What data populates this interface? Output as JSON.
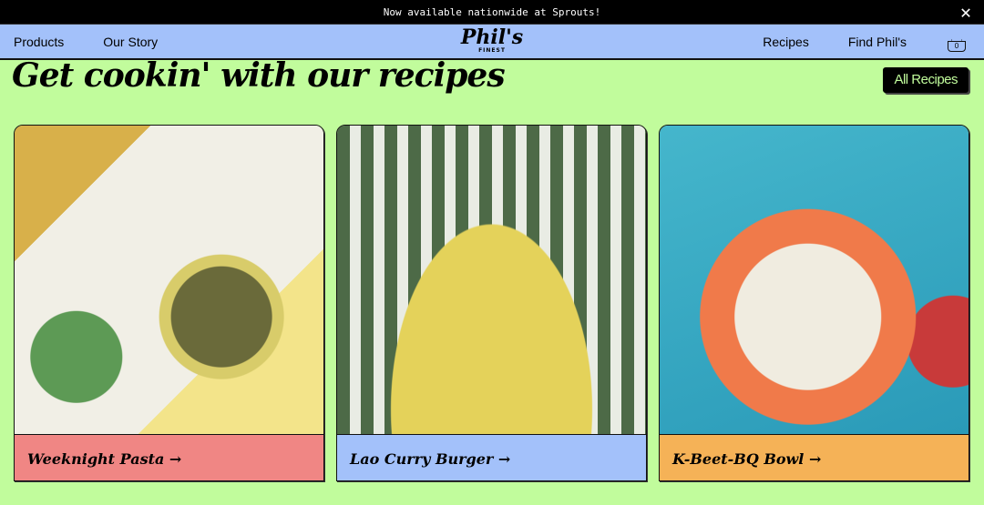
{
  "banner": {
    "text": "Now available nationwide at Sprouts!",
    "close_icon": "close-icon"
  },
  "nav": {
    "left": [
      "Products",
      "Our Story"
    ],
    "logo": "Phil's",
    "logo_sub": "FINEST",
    "right": [
      "Recipes",
      "Find Phil's"
    ],
    "cart_count": "0"
  },
  "section": {
    "title": "Get cookin' with our recipes",
    "all_button": "All Recipes"
  },
  "cards": [
    {
      "label": "Weeknight Pasta →",
      "color": "#f08684"
    },
    {
      "label": "Lao Curry Burger →",
      "color": "#a3c1fa"
    },
    {
      "label": "K-Beet-BQ Bowl →",
      "color": "#f5b257"
    }
  ]
}
